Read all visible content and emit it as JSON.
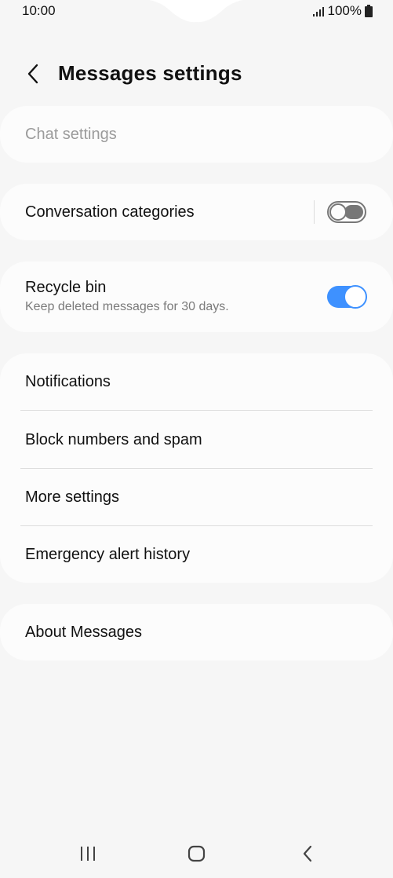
{
  "status_bar": {
    "time": "10:00",
    "battery": "100%",
    "signal_icon": "signal-icon",
    "battery_icon": "battery-icon"
  },
  "header": {
    "title": "Messages settings",
    "back_icon": "chevron-left-icon"
  },
  "sections": {
    "chat_settings": {
      "label": "Chat settings",
      "enabled": false
    },
    "conversation_categories": {
      "label": "Conversation categories",
      "toggle": "off"
    },
    "recycle_bin": {
      "label": "Recycle bin",
      "subtitle": "Keep deleted messages for 30 days.",
      "toggle": "on"
    },
    "group": [
      {
        "label": "Notifications"
      },
      {
        "label": "Block numbers and spam"
      },
      {
        "label": "More settings"
      },
      {
        "label": "Emergency alert history"
      }
    ],
    "about": {
      "label": "About Messages"
    }
  },
  "nav_bar": {
    "recents_icon": "recents-icon",
    "home_icon": "home-icon",
    "back_icon": "back-icon"
  },
  "colors": {
    "background": "#f6f6f6",
    "card": "#fcfcfc",
    "accent": "#3e91ff",
    "disabled_text": "#9b9b9b",
    "toggle_off": "#777777"
  }
}
